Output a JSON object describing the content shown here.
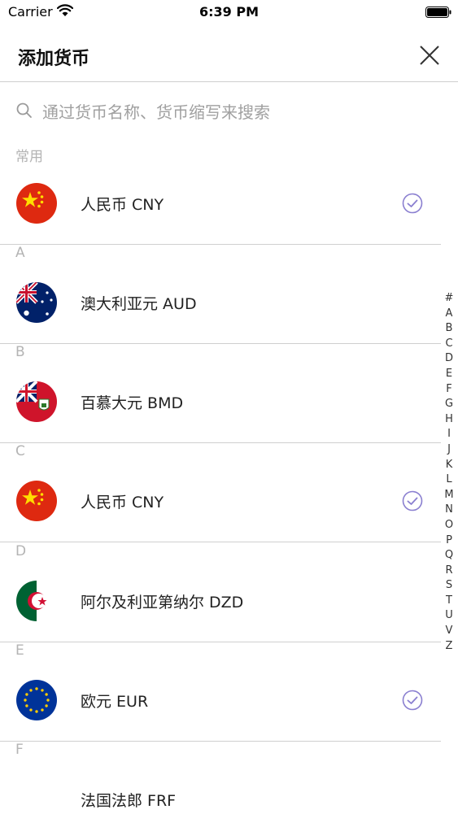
{
  "status_bar": {
    "carrier": "Carrier",
    "time": "6:39 PM"
  },
  "header": {
    "title": "添加货币"
  },
  "search": {
    "placeholder": "通过货币名称、货币缩写来搜索"
  },
  "sections": [
    {
      "header": "常用",
      "rows": [
        {
          "name": "人民币",
          "code": "CNY",
          "label": "人民币  CNY",
          "flag": "cn-flag-icon",
          "selected": true
        }
      ]
    },
    {
      "header": "A",
      "rows": [
        {
          "name": "澳大利亚元",
          "code": "AUD",
          "label": "澳大利亚元  AUD",
          "flag": "au-flag-icon",
          "selected": false
        }
      ]
    },
    {
      "header": "B",
      "rows": [
        {
          "name": "百慕大元",
          "code": "BMD",
          "label": "百慕大元  BMD",
          "flag": "bm-flag-icon",
          "selected": false
        }
      ]
    },
    {
      "header": "C",
      "rows": [
        {
          "name": "人民币",
          "code": "CNY",
          "label": "人民币  CNY",
          "flag": "cn-flag-icon",
          "selected": true
        }
      ]
    },
    {
      "header": "D",
      "rows": [
        {
          "name": "阿尔及利亚第纳尔",
          "code": "DZD",
          "label": "阿尔及利亚第纳尔  DZD",
          "flag": "dz-flag-icon",
          "selected": false
        }
      ]
    },
    {
      "header": "E",
      "rows": [
        {
          "name": "欧元",
          "code": "EUR",
          "label": "欧元  EUR",
          "flag": "eu-flag-icon",
          "selected": true
        }
      ]
    },
    {
      "header": "F",
      "rows": [
        {
          "name": "法国法郎",
          "code": "FRF",
          "label": "法国法郎  FRF",
          "flag": "",
          "selected": false
        }
      ]
    }
  ],
  "index_letters": [
    "#",
    "A",
    "B",
    "C",
    "D",
    "E",
    "F",
    "G",
    "H",
    "I",
    "J",
    "K",
    "L",
    "M",
    "N",
    "O",
    "P",
    "Q",
    "R",
    "S",
    "T",
    "U",
    "V",
    "Z"
  ],
  "colors": {
    "accent": "#8a7fd0",
    "divider": "#cfcfcf",
    "section_text": "#b4b4b4"
  }
}
